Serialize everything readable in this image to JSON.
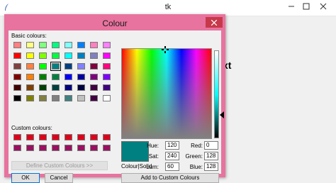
{
  "main_window": {
    "title": "tk",
    "background_text": "xt"
  },
  "dialog": {
    "title": "Colour",
    "basic_colours_label": "Basic colours:",
    "custom_colours_label": "Custom colours:",
    "basic_colours": [
      [
        "#ff8080",
        "#ffff80",
        "#80ff80",
        "#00ff80",
        "#80ffff",
        "#0080ff",
        "#ff80c0",
        "#ff80ff"
      ],
      [
        "#ff0000",
        "#ffff00",
        "#80ff00",
        "#00ff40",
        "#00ffff",
        "#0080c0",
        "#8080c0",
        "#ff00ff"
      ],
      [
        "#804040",
        "#ff8040",
        "#00ff00",
        "#008080",
        "#004080",
        "#8080ff",
        "#800040",
        "#ff0080"
      ],
      [
        "#800000",
        "#ff8000",
        "#008000",
        "#008040",
        "#0000ff",
        "#0000a0",
        "#800080",
        "#8000ff"
      ],
      [
        "#400000",
        "#804000",
        "#004000",
        "#004040",
        "#000080",
        "#000040",
        "#400040",
        "#400080"
      ],
      [
        "#000000",
        "#808000",
        "#808040",
        "#808080",
        "#408080",
        "#c0c0c0",
        "#400040",
        "#ffffff"
      ]
    ],
    "selected_basic": "#008080",
    "custom_colours": [
      [
        "#e0001a",
        "#e0001a",
        "#e0001a",
        "#e0001a",
        "#e0001a",
        "#e0001a",
        "#e0001a",
        "#e0001a"
      ],
      [
        "#9a1060",
        "#9a1060",
        "#9a1060",
        "#9a1060",
        "#9a1060",
        "#9a1060",
        "#9a1060",
        "#9a1060"
      ]
    ],
    "define_custom_button": "Define Custom Colours >>",
    "ok_button": "OK",
    "cancel_button": "Cancel",
    "add_custom_button": "Add to Custom Colours",
    "preview_label": "Colour|Solid",
    "preview_colour": "#008080",
    "fields": {
      "hue_label": "Hue:",
      "hue": "120",
      "sat_label": "Sat:",
      "sat": "240",
      "lum_label": "Lum:",
      "lum": "60",
      "red_label": "Red:",
      "red": "0",
      "green_label": "Green:",
      "green": "128",
      "blue_label": "Blue:",
      "blue": "128"
    }
  },
  "colors": {
    "dialog_frame": "#e8739e",
    "close_button": "#c7394a"
  }
}
